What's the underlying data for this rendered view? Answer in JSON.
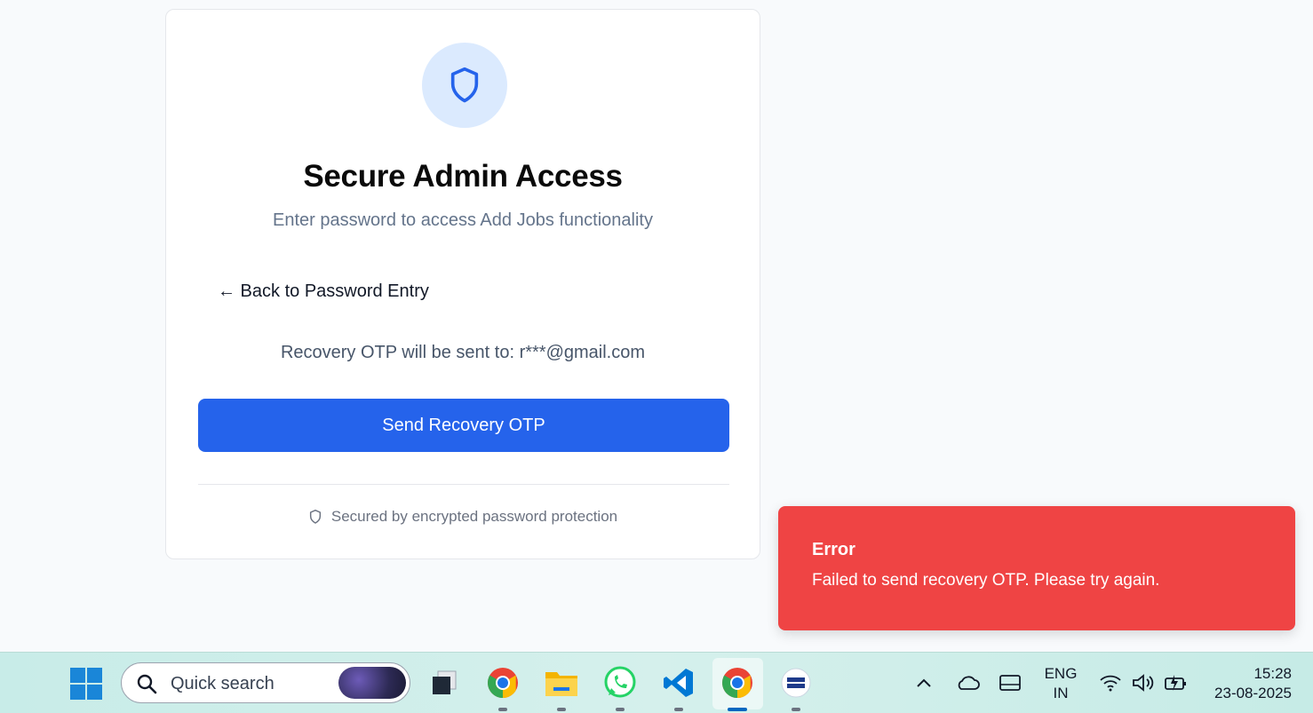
{
  "card": {
    "title": "Secure Admin Access",
    "subtitle": "Enter password to access Add Jobs functionality",
    "back_link": "← Back to Password Entry",
    "recovery_text": "Recovery OTP will be sent to: r***@gmail.com",
    "send_button": "Send Recovery OTP",
    "secured_text": "Secured by encrypted password protection"
  },
  "toast": {
    "title": "Error",
    "message": "Failed to send recovery OTP. Please try again."
  },
  "taskbar": {
    "search_placeholder": "Quick search",
    "language_line1": "ENG",
    "language_line2": "IN",
    "time": "15:28",
    "date": "23-08-2025",
    "apps": [
      "task-view",
      "chrome",
      "file-explorer",
      "whatsapp",
      "vscode",
      "chrome-active",
      "nxtwave"
    ]
  },
  "colors": {
    "primary": "#2563eb",
    "error": "#ef4444",
    "shield_bg": "#dbeafe"
  }
}
